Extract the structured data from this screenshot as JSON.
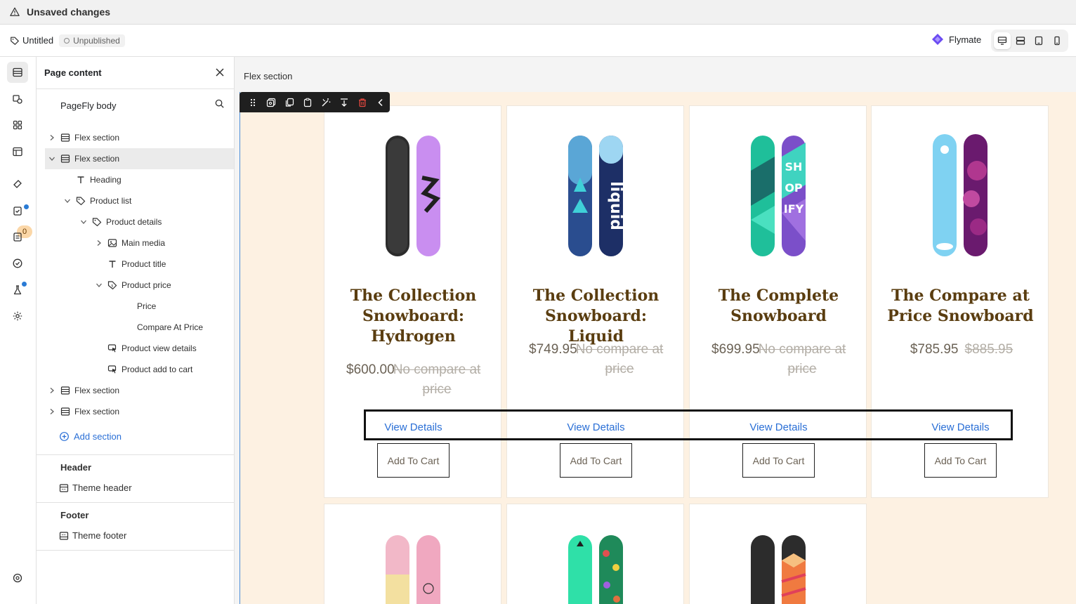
{
  "top_bar": {
    "status_text": "Unsaved changes"
  },
  "header": {
    "page_name": "Untitled",
    "status_badge": "Unpublished",
    "app_name": "Flymate"
  },
  "rail": {
    "notification_count": "0"
  },
  "panel": {
    "title": "Page content",
    "body_label": "PageFly body",
    "tree": [
      {
        "label": "Flex section",
        "icon": "section-icon",
        "expanded": false
      },
      {
        "label": "Flex section",
        "icon": "section-icon",
        "expanded": true,
        "selected": true
      },
      {
        "label": "Heading",
        "icon": "text-icon"
      },
      {
        "label": "Product list",
        "icon": "tag-icon",
        "expanded": true
      },
      {
        "label": "Product details",
        "icon": "tag-icon",
        "expanded": true
      },
      {
        "label": "Main media",
        "icon": "image-icon",
        "expanded": false
      },
      {
        "label": "Product title",
        "icon": "text-icon"
      },
      {
        "label": "Product price",
        "icon": "price-icon",
        "expanded": true
      },
      {
        "label": "Price"
      },
      {
        "label": "Compare At Price"
      },
      {
        "label": "Product view details",
        "icon": "cursor-icon"
      },
      {
        "label": "Product add to cart",
        "icon": "cursor-icon"
      },
      {
        "label": "Flex section",
        "icon": "section-icon",
        "expanded": false
      },
      {
        "label": "Flex section",
        "icon": "section-icon",
        "expanded": false
      }
    ],
    "add_section_label": "Add section",
    "header_group": {
      "title": "Header",
      "item": "Theme header"
    },
    "footer_group": {
      "title": "Footer",
      "item": "Theme footer"
    }
  },
  "canvas": {
    "section_label": "Flex section",
    "products": [
      {
        "title": "The Collection Snowboard: Hydrogen",
        "price": "$600.00",
        "compare": "No compare at price",
        "view_details": "View Details",
        "add_to_cart": "Add To Cart"
      },
      {
        "title": "The Collection Snowboard: Liquid",
        "price": "$749.95",
        "compare": "No compare at price",
        "view_details": "View Details",
        "add_to_cart": "Add To Cart"
      },
      {
        "title": "The Complete Snowboard",
        "price": "$699.95",
        "compare": "No compare at price",
        "view_details": "View Details",
        "add_to_cart": "Add To Cart"
      },
      {
        "title": "The Compare at Price Snowboard",
        "price": "$785.95",
        "compare": "$885.95",
        "view_details": "View Details",
        "add_to_cart": "Add To Cart"
      }
    ]
  },
  "colors": {
    "accent_blue": "#2a6fd6",
    "title_brown": "#5a3d10",
    "canvas_bg": "#fdf1e2",
    "toolbar_bg": "#1f1f1f",
    "delete_red": "#e5483f"
  }
}
